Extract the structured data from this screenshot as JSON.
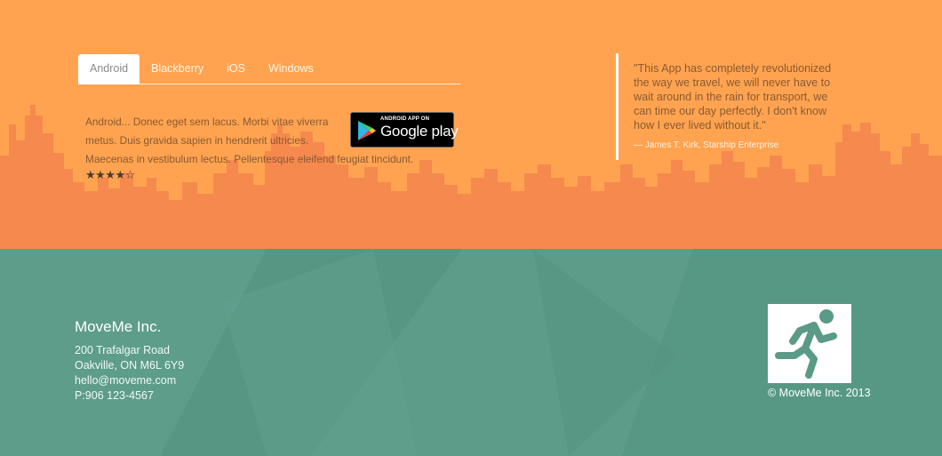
{
  "tabs": {
    "items": [
      {
        "label": "Android",
        "active": true
      },
      {
        "label": "Blackberry",
        "active": false
      },
      {
        "label": "iOS",
        "active": false
      },
      {
        "label": "Windows",
        "active": false
      }
    ]
  },
  "app_description": {
    "lines": [
      "Android... Donec eget sem lacus. Morbi vitae viverra",
      "metus. Duis gravida sapien in hendrerit ultricies.",
      "Maecenas in vestibulum lectus. Pellentesque eleifend feugiat tincidunt."
    ],
    "rating": 4,
    "rating_max": 5,
    "stars_text": "★★★★☆"
  },
  "store_badge": {
    "top_text": "ANDROID APP ON",
    "main_text": "Google play",
    "icon": "play-triangle-icon"
  },
  "testimonial": {
    "lines": [
      "\"This App has completely revolutionized",
      "the way we travel, we will never have to",
      "wait around in the rain for transport, we",
      "can time our day perfectly. I don't know",
      "how I ever lived without it.\""
    ],
    "author": "— James T. Kirk, Starship Enterprise"
  },
  "footer": {
    "company": "MoveMe Inc.",
    "address_line1": "200 Trafalgar Road",
    "address_line2": "Oakville, ON M6L 6Y9",
    "email": "hello@moveme.com",
    "phone": "P:906 123-4567",
    "logo_icon": "running-man-icon",
    "copyright": "© MoveMe Inc. 2013"
  },
  "colors": {
    "orange": "#ffa350",
    "skyline": "#f5894e",
    "teal": "#5a9a87"
  }
}
